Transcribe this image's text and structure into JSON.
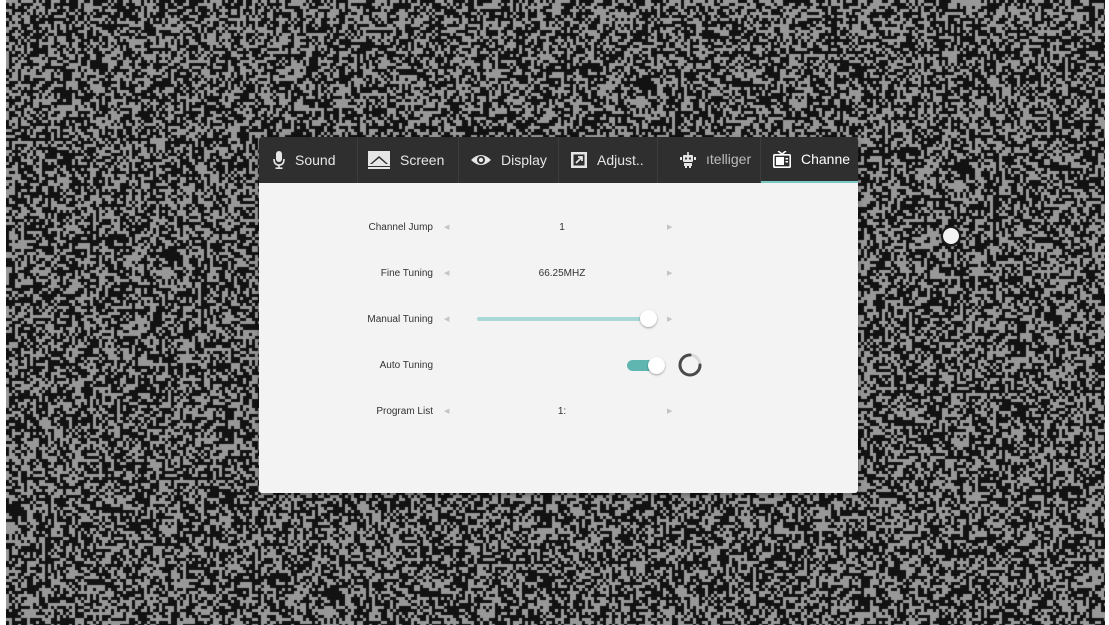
{
  "colors": {
    "tabbar_bg": "#2f2f2f",
    "panel_bg": "#f3f3f3",
    "accent": "#79c7c2",
    "toggle_on": "#5fb6b1",
    "slider_track": "#a9d9d6",
    "text": "#333333",
    "arrow": "#c4c4c4"
  },
  "tabs": [
    {
      "label": "Sound",
      "icon": "microphone-icon",
      "selected": false
    },
    {
      "label": "Screen",
      "icon": "screen-icon",
      "selected": false
    },
    {
      "label": "Display",
      "icon": "eye-icon",
      "selected": false
    },
    {
      "label": "Adjust..",
      "icon": "adjust-icon",
      "selected": false
    },
    {
      "label": "ıtelliger",
      "icon": "robot-icon",
      "selected": false
    },
    {
      "label": "Channe",
      "icon": "tv-icon",
      "selected": true
    }
  ],
  "rows": [
    {
      "label": "Channel Jump",
      "value": "1",
      "control": "stepper"
    },
    {
      "label": "Fine Tuning",
      "value": "66.25MHZ",
      "control": "stepper"
    },
    {
      "label": "Manual Tuning",
      "control": "slider",
      "level": 1.0
    },
    {
      "label": "Auto Tuning",
      "control": "toggle",
      "on": true,
      "busy": true
    },
    {
      "label": "Program List",
      "value": "1:",
      "control": "stepper"
    }
  ],
  "arrows": {
    "left": "◀",
    "right": "▶"
  }
}
